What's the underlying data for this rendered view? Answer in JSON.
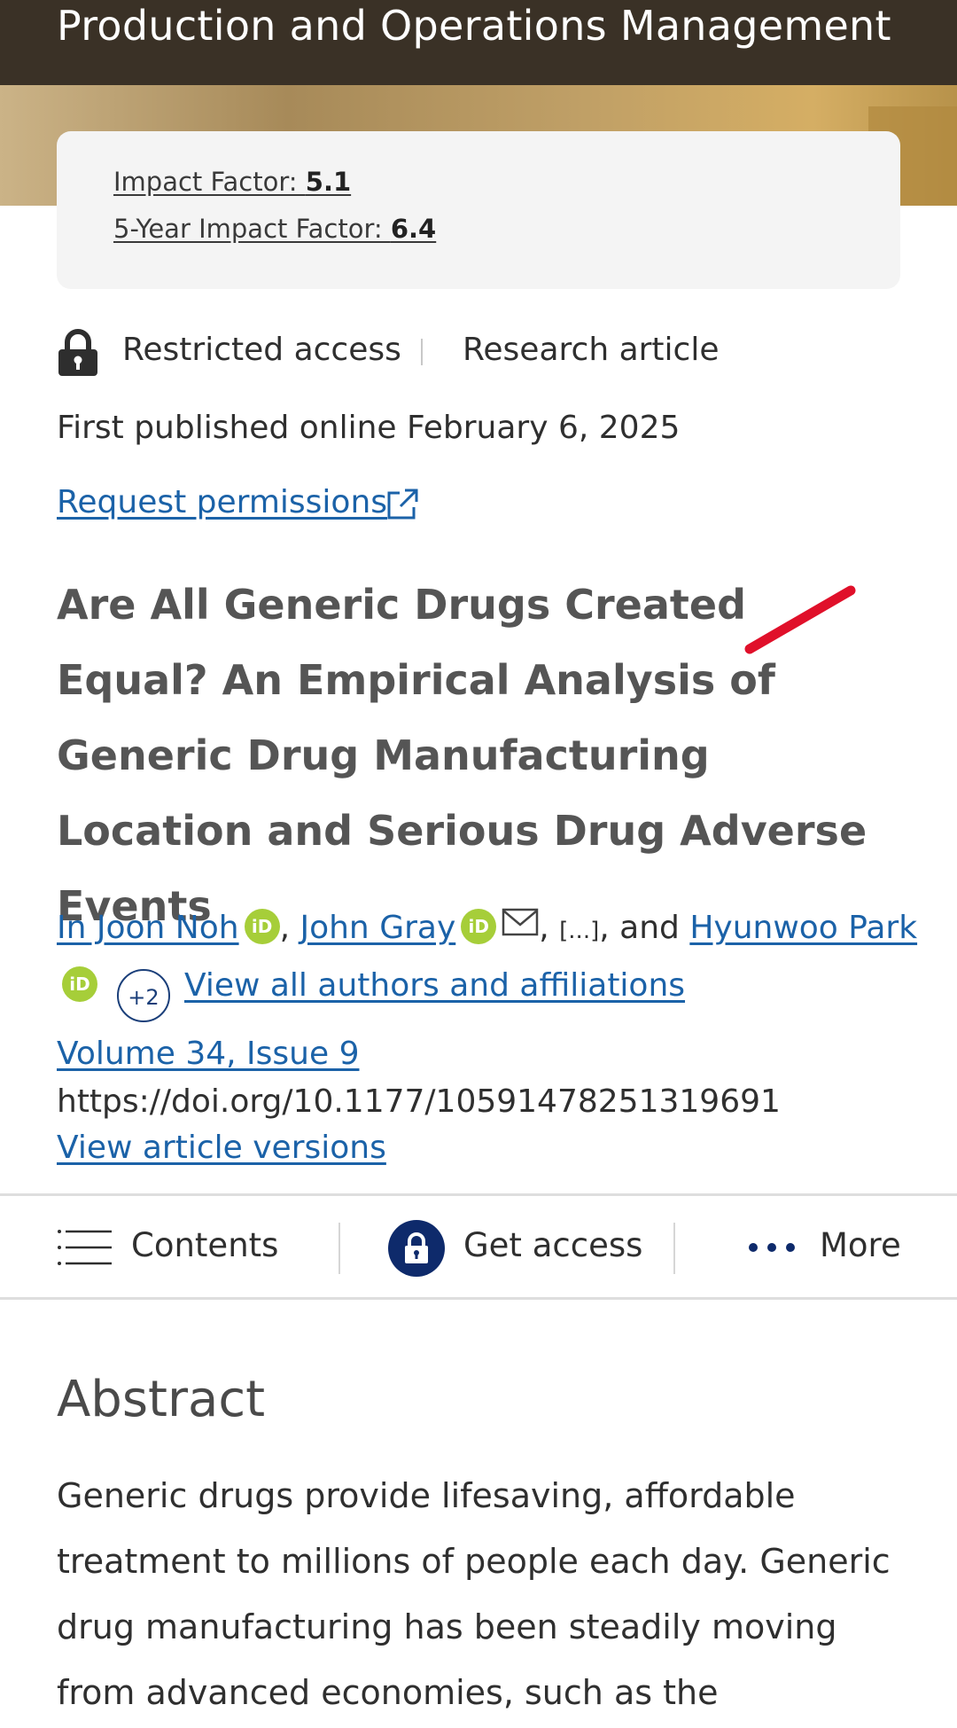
{
  "journal": {
    "title": "Production and Operations Management"
  },
  "impact": {
    "if_label": "Impact Factor: ",
    "if_value": "5.1",
    "if5_label": "5-Year Impact Factor: ",
    "if5_value": "6.4"
  },
  "article": {
    "access": "Restricted access",
    "type": "Research article",
    "published": "First published online February 6, 2025",
    "request_permissions": "Request permissions",
    "title": "Are All Generic Drugs Created Equal? An Empirical Analysis of Generic Drug Manufacturing Location and Serious Drug Adverse Events",
    "volume": "Volume 34, Issue 9",
    "doi": "https://doi.org/10.1177/10591478251319691",
    "view_versions": "View article versions"
  },
  "authors": {
    "author1": "In Joon Noh",
    "author2": "John Gray",
    "ellipsis": "[...]",
    "and": "and",
    "author3": "Hyunwoo Park",
    "orcid_badge": "iD",
    "more_count": "+2",
    "view_all": "View all authors and affiliations",
    "sep_comma": ",",
    "sep_comma_space": ", "
  },
  "actions": {
    "contents": "Contents",
    "get_access": "Get access",
    "more": "More"
  },
  "abstract": {
    "heading": "Abstract",
    "text": "Generic drugs provide lifesaving, affordable treatment to millions of people each day. Generic drug manufacturing has been steadily moving from advanced economies, such as the"
  },
  "colors": {
    "header_bg": "#3a3126",
    "link": "#1b62a8",
    "orcid": "#a6ce39",
    "navy": "#0e2a6b",
    "annotation": "#e0102a"
  },
  "icons": {
    "lock": "lock-icon",
    "external": "external-link-icon",
    "orcid": "orcid-icon",
    "mail": "mail-icon",
    "menu": "menu-icon",
    "get_access": "lock-circle-icon",
    "more": "more-dots-icon"
  }
}
